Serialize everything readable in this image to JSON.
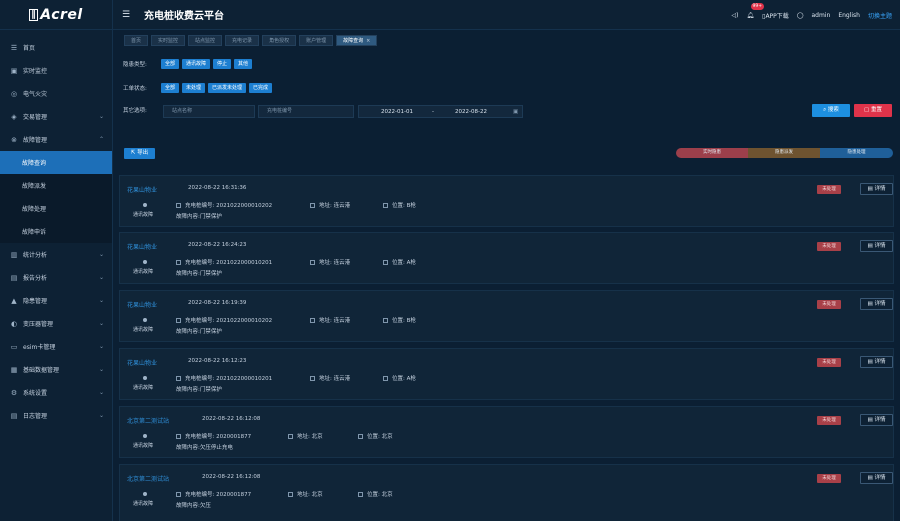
{
  "app": {
    "logo_mark": "∥",
    "logo": "Acrel",
    "title": "充电桩收费云平台"
  },
  "header": {
    "badge": "99+",
    "app_download": "APP下载",
    "user": "admin",
    "lang": "English",
    "theme": "切换主题"
  },
  "sidebar": {
    "items": [
      {
        "label": "首页",
        "icon": "home-icon",
        "glyph": "☰"
      },
      {
        "label": "实时监控",
        "icon": "monitor-icon",
        "glyph": "▣"
      },
      {
        "label": "电气火灾",
        "icon": "fire-icon",
        "glyph": "◎"
      },
      {
        "label": "交易管理",
        "icon": "trade-icon",
        "glyph": "◈"
      },
      {
        "label": "故障管理",
        "icon": "fault-icon",
        "glyph": "⊗"
      }
    ],
    "fault_sub": [
      {
        "label": "故障查询"
      },
      {
        "label": "故障派发"
      },
      {
        "label": "故障处理"
      },
      {
        "label": "故障申诉"
      }
    ],
    "items2": [
      {
        "label": "统计分析",
        "icon": "chart-icon",
        "glyph": "▥"
      },
      {
        "label": "报告分析",
        "icon": "report-icon",
        "glyph": "▤"
      },
      {
        "label": "隐患管理",
        "icon": "warning-icon",
        "glyph": "▲"
      },
      {
        "label": "变压器管理",
        "icon": "transformer-icon",
        "glyph": "◐"
      },
      {
        "label": "esim卡管理",
        "icon": "sim-icon",
        "glyph": "▭"
      },
      {
        "label": "基础数据管理",
        "icon": "database-icon",
        "glyph": "▦"
      },
      {
        "label": "系统设置",
        "icon": "settings-icon",
        "glyph": "⚙"
      },
      {
        "label": "日志管理",
        "icon": "log-icon",
        "glyph": "▤"
      }
    ]
  },
  "tabs": [
    {
      "label": "首页"
    },
    {
      "label": "实时监控"
    },
    {
      "label": "站点监控"
    },
    {
      "label": "充电记录"
    },
    {
      "label": "角色授权"
    },
    {
      "label": "账户管理"
    },
    {
      "label": "故障查询"
    }
  ],
  "filters": {
    "fault_type_label": "隐患类型:",
    "fault_types": [
      "全部",
      "通讯故障",
      "停止",
      "其他"
    ],
    "order_status_label": "工单状态:",
    "order_statuses": [
      "全部",
      "未处理",
      "已派发未处理",
      "已完成"
    ],
    "other_label": "其它选项:",
    "site_placeholder": "站点名称",
    "pile_placeholder": "充电桩编号",
    "date_from": "2022-01-01",
    "date_sep": "-",
    "date_to": "2022-08-22",
    "search": "搜索",
    "reset": "重置"
  },
  "toolbar": {
    "export": "导出"
  },
  "legend": [
    "实时隐患",
    "隐患派发",
    "隐患处理"
  ],
  "labels": {
    "pile": "充电桩编号:",
    "addr": "地址:",
    "pos": "位置:",
    "detail": "详情",
    "type": "通讯故障"
  },
  "records": [
    {
      "site": "花果山物业",
      "time": "2022-08-22 16:31:36",
      "pile": "2021022000010202",
      "addr": "连云港",
      "pos": "B枪",
      "content": "故障内容:门禁保护",
      "status": "未处理"
    },
    {
      "site": "花果山物业",
      "time": "2022-08-22 16:24:23",
      "pile": "2021022000010201",
      "addr": "连云港",
      "pos": "A枪",
      "content": "故障内容:门禁保护",
      "status": "未处理"
    },
    {
      "site": "花果山物业",
      "time": "2022-08-22 16:19:39",
      "pile": "2021022000010202",
      "addr": "连云港",
      "pos": "B枪",
      "content": "故障内容:门禁保护",
      "status": "未处理"
    },
    {
      "site": "花果山物业",
      "time": "2022-08-22 16:12:23",
      "pile": "2021022000010201",
      "addr": "连云港",
      "pos": "A枪",
      "content": "故障内容:门禁保护",
      "status": "未处理"
    },
    {
      "site": "北京第二测试站",
      "time": "2022-08-22 16:12:08",
      "pile": "2020001877",
      "addr": "北京",
      "pos": "北京",
      "content": "故障内容:欠压停止充电",
      "status": "未处理"
    },
    {
      "site": "北京第二测试站",
      "time": "2022-08-22 16:12:08",
      "pile": "2020001877",
      "addr": "北京",
      "pos": "北京",
      "content": "故障内容:欠压",
      "status": "未处理"
    }
  ],
  "colors": {
    "accent": "#1d7fd1",
    "active_menu": "#1d6fb8",
    "danger": "#e0334a",
    "status_bg": "#a84048"
  }
}
